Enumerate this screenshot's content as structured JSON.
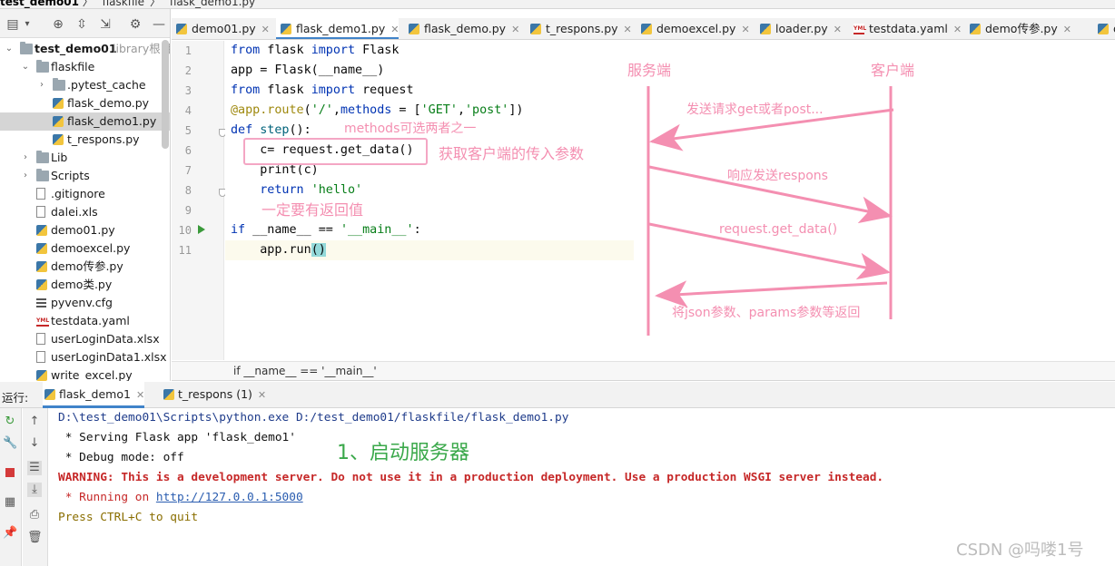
{
  "breadcrumb": [
    "test_demo01",
    "flaskfile",
    "flask_demo1.py"
  ],
  "project": {
    "tree": [
      {
        "label": "test_demo01",
        "suffix": "library根目录",
        "icon": "folder-icon",
        "indent": 0,
        "arrow": "v",
        "bold": true
      },
      {
        "label": "flaskfile",
        "icon": "folder-icon",
        "indent": 1,
        "arrow": "v"
      },
      {
        "label": ".pytest_cache",
        "icon": "folder-icon",
        "indent": 2,
        "arrow": ">"
      },
      {
        "label": "flask_demo.py",
        "icon": "python-file-icon",
        "indent": 2
      },
      {
        "label": "flask_demo1.py",
        "icon": "python-file-icon",
        "indent": 2,
        "selected": true
      },
      {
        "label": "t_respons.py",
        "icon": "python-file-icon",
        "indent": 2
      },
      {
        "label": "Lib",
        "icon": "folder-icon",
        "indent": 1,
        "arrow": ">"
      },
      {
        "label": "Scripts",
        "icon": "folder-icon",
        "indent": 1,
        "arrow": ">"
      },
      {
        "label": ".gitignore",
        "icon": "file-icon",
        "indent": 1
      },
      {
        "label": "dalei.xls",
        "icon": "excel-file-icon",
        "indent": 1
      },
      {
        "label": "demo01.py",
        "icon": "python-file-icon",
        "indent": 1
      },
      {
        "label": "demoexcel.py",
        "icon": "python-file-icon",
        "indent": 1
      },
      {
        "label": "demo传参.py",
        "icon": "python-file-icon",
        "indent": 1
      },
      {
        "label": "demo类.py",
        "icon": "python-file-icon",
        "indent": 1
      },
      {
        "label": "pyvenv.cfg",
        "icon": "config-file-icon",
        "indent": 1
      },
      {
        "label": "testdata.yaml",
        "icon": "yaml-file-icon",
        "indent": 1
      },
      {
        "label": "userLoginData.xlsx",
        "icon": "excel-file-icon",
        "indent": 1
      },
      {
        "label": "userLoginData1.xlsx",
        "icon": "excel-file-icon",
        "indent": 1
      },
      {
        "label": "write_excel.py",
        "icon": "python-file-icon",
        "indent": 1
      }
    ]
  },
  "tabs": [
    {
      "label": "demo01.py",
      "icon": "python-file-icon"
    },
    {
      "label": "flask_demo1.py",
      "icon": "python-file-icon",
      "active": true
    },
    {
      "label": "flask_demo.py",
      "icon": "python-file-icon"
    },
    {
      "label": "t_respons.py",
      "icon": "python-file-icon"
    },
    {
      "label": "demoexcel.py",
      "icon": "python-file-icon"
    },
    {
      "label": "loader.py",
      "icon": "python-file-icon"
    },
    {
      "label": "testdata.yaml",
      "icon": "yaml-file-icon"
    },
    {
      "label": "demo传参.py",
      "icon": "python-file-icon"
    },
    {
      "label": "de",
      "icon": "python-file-icon"
    }
  ],
  "editor": {
    "line_numbers": [
      "1",
      "2",
      "3",
      "4",
      "5",
      "6",
      "7",
      "8",
      "9",
      "10",
      "11"
    ],
    "code_breadcrumb": "if __name__ == '__main__'"
  },
  "annotations": {
    "server_label": "服务端",
    "client_label": "客户端",
    "send_request": "发送请求get或者post...",
    "methods_note": "methods可选两者之一",
    "get_params": "获取客户端的传入参数",
    "respond": "响应发送respons",
    "must_return": "一定要有返回值",
    "get_data": "request.get_data()",
    "return_params": "将json参数、params参数等返回",
    "start_server": "1、启动服务器"
  },
  "run": {
    "label": "运行:",
    "tabs": [
      {
        "label": "flask_demo1",
        "active": true
      },
      {
        "label": "t_respons (1)"
      }
    ],
    "console": {
      "cmd": "D:\\test_demo01\\Scripts\\python.exe D:/test_demo01/flaskfile/flask_demo1.py",
      "serving": " * Serving Flask app 'flask_demo1'",
      "debug": " * Debug mode: off",
      "warning": "WARNING: This is a development server. Do not use it in a production deployment. Use a production WSGI server instead.",
      "running_prefix": " * Running on ",
      "running_url": "http://127.0.0.1:5000",
      "quit": "Press CTRL+C to quit"
    }
  },
  "watermark": "CSDN @吗喽1号",
  "colors": {
    "accent": "#4083c9",
    "annotation": "#f48fb1",
    "warning": "#c62828",
    "green_note": "#3aa84a"
  }
}
